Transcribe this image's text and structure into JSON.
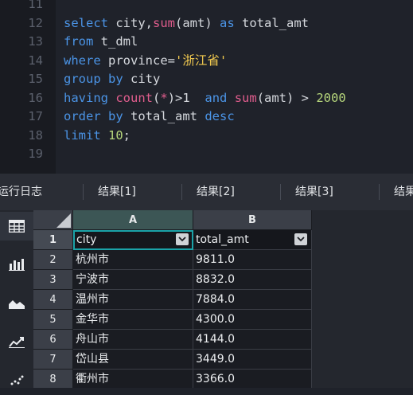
{
  "editor": {
    "lines": [
      {
        "n": "11",
        "tokens": []
      },
      {
        "n": "12",
        "tokens": [
          [
            "kw",
            "select "
          ],
          [
            "id",
            "city,"
          ],
          [
            "fn",
            "sum"
          ],
          [
            "id",
            "(amt) "
          ],
          [
            "kw",
            "as "
          ],
          [
            "id",
            "total_amt"
          ]
        ]
      },
      {
        "n": "13",
        "tokens": [
          [
            "kw",
            "from "
          ],
          [
            "id",
            "t_dml"
          ]
        ]
      },
      {
        "n": "14",
        "tokens": [
          [
            "kw",
            "where "
          ],
          [
            "id",
            "province="
          ],
          [
            "str",
            "'浙江省'"
          ]
        ]
      },
      {
        "n": "15",
        "tokens": [
          [
            "kw",
            "group by "
          ],
          [
            "id",
            "city"
          ]
        ]
      },
      {
        "n": "16",
        "tokens": [
          [
            "kw",
            "having "
          ],
          [
            "fn",
            "count"
          ],
          [
            "id",
            "("
          ],
          [
            "fn",
            "*"
          ],
          [
            "id",
            ")>1  "
          ],
          [
            "kw",
            "and "
          ],
          [
            "fn",
            "sum"
          ],
          [
            "id",
            "(amt) > "
          ],
          [
            "num",
            "2000"
          ]
        ]
      },
      {
        "n": "17",
        "tokens": [
          [
            "kw",
            "order by "
          ],
          [
            "id",
            "total_amt "
          ],
          [
            "kw",
            "desc"
          ]
        ]
      },
      {
        "n": "18",
        "tokens": [
          [
            "kw",
            "limit "
          ],
          [
            "num",
            "10"
          ],
          [
            "id",
            ";"
          ]
        ]
      },
      {
        "n": "19",
        "tokens": []
      }
    ]
  },
  "tabs": [
    "运行日志",
    "结果[1]",
    "结果[2]",
    "结果[3]",
    "结果"
  ],
  "tools": [
    "table-grid-icon",
    "bar-chart-icon",
    "area-chart-icon",
    "line-chart-icon",
    "scatter-icon"
  ],
  "grid": {
    "columns": [
      "A",
      "B"
    ],
    "header_row": {
      "num": "1",
      "cells": [
        "city",
        "total_amt"
      ]
    },
    "rows": [
      {
        "num": "2",
        "city": "杭州市",
        "total_amt": "9811.0"
      },
      {
        "num": "3",
        "city": "宁波市",
        "total_amt": "8832.0"
      },
      {
        "num": "4",
        "city": "温州市",
        "total_amt": "7884.0"
      },
      {
        "num": "5",
        "city": "金华市",
        "total_amt": "4300.0"
      },
      {
        "num": "6",
        "city": "舟山市",
        "total_amt": "4144.0"
      },
      {
        "num": "7",
        "city": "岱山县",
        "total_amt": "3449.0"
      },
      {
        "num": "8",
        "city": "衢州市",
        "total_amt": "3366.0"
      }
    ]
  },
  "colors": {
    "keyword": "#4b94e6",
    "function": "#e05d8d",
    "string": "#f1c94f",
    "number": "#b7d77c",
    "selection": "#1ba3a8"
  }
}
